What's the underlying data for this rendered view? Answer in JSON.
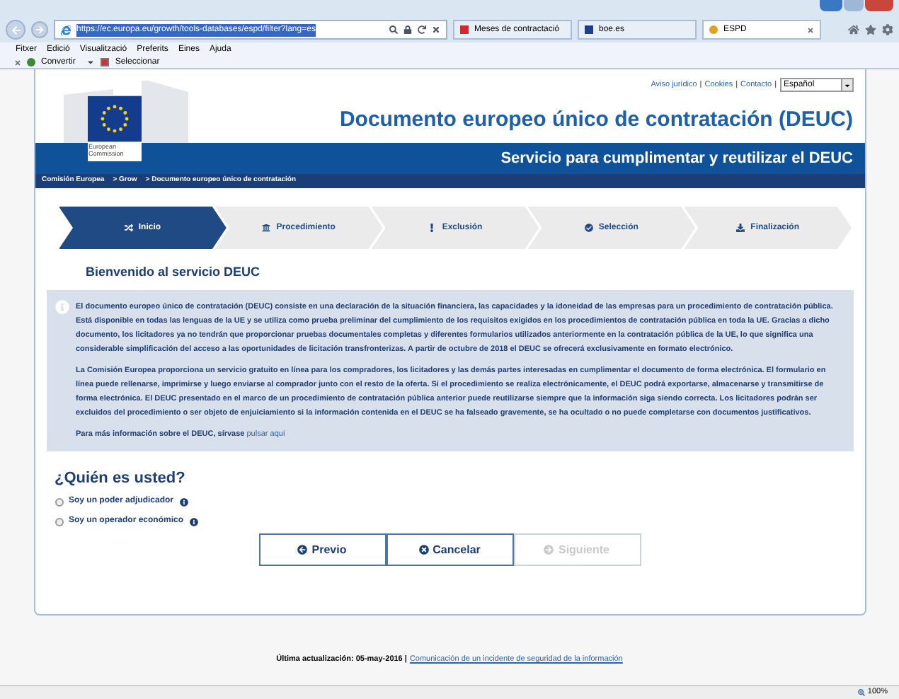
{
  "browser": {
    "address": "https://ec.europa.eu/growth/tools-databases/espd/filter?lang=es",
    "tabs": [
      {
        "label": "Meses de contractació",
        "selected": false
      },
      {
        "label": "boe.es",
        "selected": false
      },
      {
        "label": "ESPD",
        "selected": true
      }
    ],
    "menu": [
      "Fitxer",
      "Edició",
      "Visualització",
      "Preferits",
      "Eines",
      "Ajuda"
    ],
    "toolbar": [
      "Convertir",
      "Seleccionar"
    ]
  },
  "page": {
    "logo_text": [
      "European",
      "Commission"
    ],
    "top_links": [
      "Aviso jurídico",
      "Cookies",
      "Contacto"
    ],
    "link_separator": "|",
    "language": "Español",
    "title": "Documento europeo único de contratación (DEUC)",
    "subtitle": "Servicio para cumplimentar y reutilizar el DEUC",
    "breadcrumb": [
      "Comisión Europea",
      "> Grow",
      "> Documento europeo único de contratación"
    ],
    "steps": [
      {
        "label": "Inicio",
        "kind": "start",
        "selected": true
      },
      {
        "label": "Procedimiento",
        "kind": "procedure",
        "selected": false
      },
      {
        "label": "Exclusión",
        "kind": "exclusion",
        "selected": false
      },
      {
        "label": "Selección",
        "kind": "selection",
        "selected": false
      },
      {
        "label": "Finalización",
        "kind": "finish",
        "selected": false
      }
    ],
    "welcome": "Bienvenido al servicio DEUC",
    "info_paragraphs": [
      "El documento europeo único de contratación (DEUC) consiste en una declaración de la situación financiera, las capacidades y la idoneidad de las empresas para un procedimiento de contratación pública. Está disponible en todas las lenguas de la UE y se utiliza como prueba preliminar del cumplimiento de los requisitos exigidos en los procedimientos de contratación pública en toda la UE. Gracias a dicho documento, los licitadores ya no tendrán que proporcionar pruebas documentales completas y diferentes formularios utilizados anteriormente en la contratación pública de la UE, lo que significa una considerable simplificación del acceso a las oportunidades de licitación transfronterizas. A partir de octubre de 2018 el DEUC se ofrecerá exclusivamente en formato electrónico.",
      "La Comisión Europea proporciona un servicio gratuito en línea para los compradores, los licitadores y las demás partes interesadas en cumplimentar el documento de forma electrónica. El formulario en línea puede rellenarse, imprimirse y luego enviarse al comprador junto con el resto de la oferta. Si el procedimiento se realiza electrónicamente, el DEUC podrá exportarse, almacenarse y transmitirse de forma electrónica. El DEUC presentado en el marco de un procedimiento de contratación pública anterior puede reutilizarse siempre que la información siga siendo correcta. Los licitadores podrán ser excluidos del procedimiento o ser objeto de enjuiciamiento si la información contenida en el DEUC se ha falseado gravemente, se ha ocultado o no puede completarse con documentos justificativos."
    ],
    "more_info": "Para más información sobre el DEUC, sírvase",
    "more_info_link": "pulsar aquí",
    "question": "¿Quién es usted?",
    "options": [
      {
        "label": "Soy un poder adjudicador",
        "selected": false
      },
      {
        "label": "Soy un operador económico",
        "selected": false
      }
    ],
    "buttons": [
      {
        "label": "Previo",
        "kind": "previous",
        "disabled": false
      },
      {
        "label": "Cancelar",
        "kind": "cancel",
        "disabled": false
      },
      {
        "label": "Siguiente",
        "kind": "next",
        "disabled": true
      }
    ],
    "footer_updated": "Última actualización: 05-may-2016 |",
    "footer_link": "Comunicación de un incidente de seguridad de la información"
  },
  "status_bar": {
    "zoom": "100%"
  }
}
